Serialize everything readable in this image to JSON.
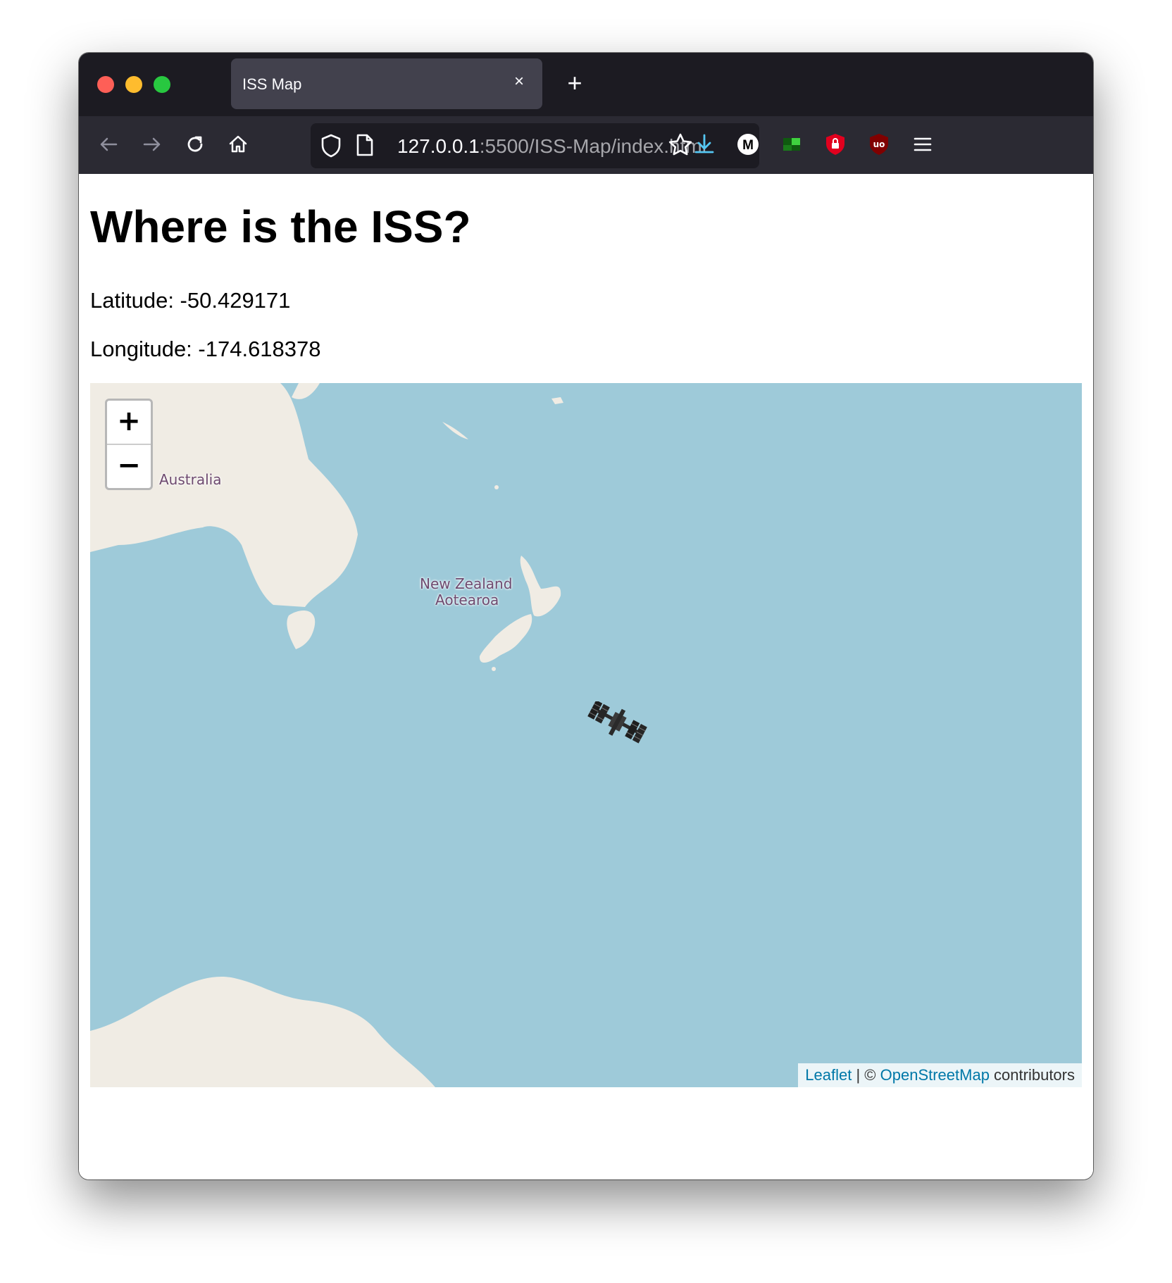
{
  "browser": {
    "tab_title": "ISS Map",
    "url_host": "127.0.0.1",
    "url_path": ":5500/ISS-Map/index.html",
    "new_tab_label": "+",
    "close_tab_label": "×"
  },
  "page": {
    "title": "Where is the ISS?",
    "latitude_text": "Latitude: -50.429171",
    "longitude_text": "Longitude: -174.618378"
  },
  "map": {
    "zoom_in_label": "+",
    "zoom_out_label": "−",
    "labels": {
      "australia": "Australia",
      "new_zealand": "New Zealand",
      "aotearoa": "Aotearoa"
    },
    "attribution": {
      "leaflet": "Leaflet",
      "separator": " | © ",
      "osm": "OpenStreetMap",
      "suffix": " contributors"
    },
    "marker_icon": "iss-icon",
    "colors": {
      "water": "#9ecad9",
      "land": "#f0ece4",
      "label": "#6e4a6f",
      "link": "#0078a8"
    }
  }
}
